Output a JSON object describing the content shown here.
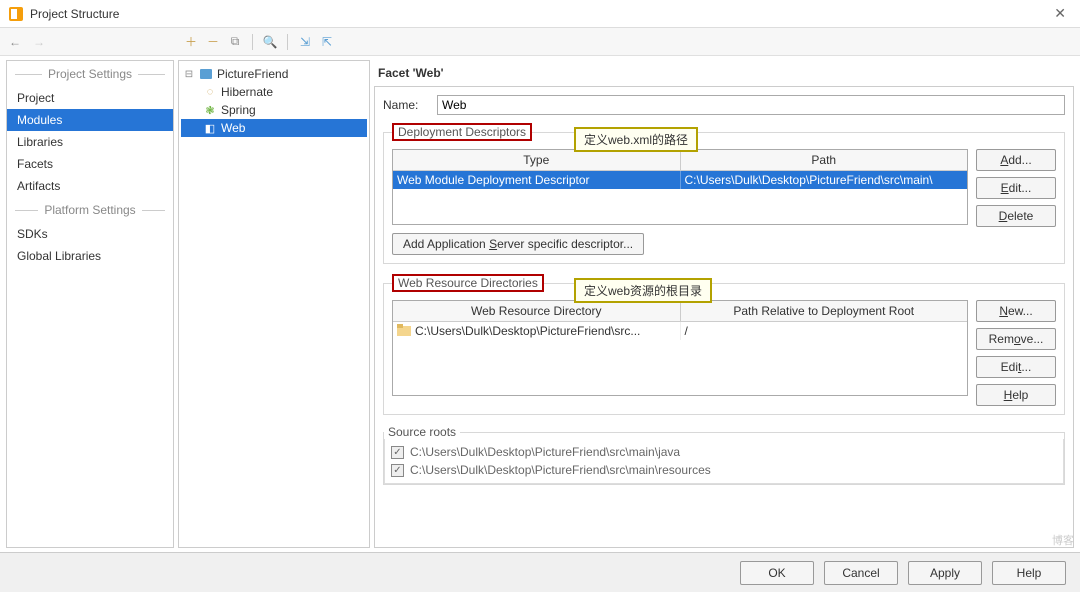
{
  "window": {
    "title": "Project Structure"
  },
  "sidebar": {
    "section_settings": "Project Settings",
    "section_platform": "Platform Settings",
    "items": [
      "Project",
      "Modules",
      "Libraries",
      "Facets",
      "Artifacts"
    ],
    "platform_items": [
      "SDKs",
      "Global Libraries"
    ],
    "selected_index": 1
  },
  "tree": {
    "root": "PictureFriend",
    "children": [
      {
        "label": "Hibernate",
        "icon": "hibernate-icon",
        "icon_glyph": "◌",
        "icon_color": "#c8a050"
      },
      {
        "label": "Spring",
        "icon": "spring-icon",
        "icon_glyph": "❃",
        "icon_color": "#6db33f"
      },
      {
        "label": "Web",
        "icon": "web-icon",
        "icon_glyph": "◧",
        "icon_color": "#3596d8",
        "selected": true
      }
    ]
  },
  "facet": {
    "title": "Facet 'Web'",
    "name_label": "Name:",
    "name_value": "Web",
    "deploy_legend": "Deployment Descriptors",
    "callout_deploy": "定义web.xml的路径",
    "deploy_headers": [
      "Type",
      "Path"
    ],
    "deploy_row": {
      "type": "Web Module Deployment Descriptor",
      "path": "C:\\Users\\Dulk\\Desktop\\PictureFriend\\src\\main\\"
    },
    "deploy_buttons": {
      "add": "Add...",
      "edit": "Edit...",
      "delete": "Delete"
    },
    "app_server_btn": "Add Application Server specific descriptor...",
    "wr_legend": "Web Resource Directories",
    "callout_wr": "定义web资源的根目录",
    "wr_headers": [
      "Web Resource Directory",
      "Path Relative to Deployment Root"
    ],
    "wr_row": {
      "dir": "C:\\Users\\Dulk\\Desktop\\PictureFriend\\src...",
      "rel": "/"
    },
    "wr_buttons": {
      "new": "New...",
      "remove": "Remove...",
      "edit": "Edit...",
      "help": "Help"
    },
    "sr_legend": "Source roots",
    "source_roots": [
      "C:\\Users\\Dulk\\Desktop\\PictureFriend\\src\\main\\java",
      "C:\\Users\\Dulk\\Desktop\\PictureFriend\\src\\main\\resources"
    ]
  },
  "footer": {
    "ok": "OK",
    "cancel": "Cancel",
    "apply": "Apply",
    "help": "Help"
  },
  "watermark": "博客"
}
